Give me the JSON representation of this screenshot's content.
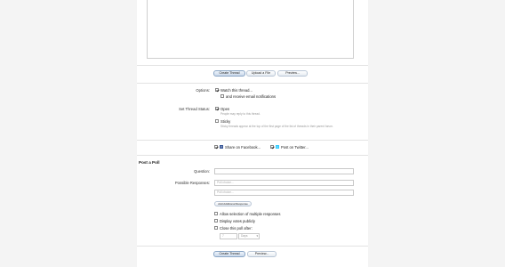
{
  "toolbar": {
    "create_thread_label": "Create Thread",
    "upload_file_label": "Upload a File",
    "preview_label": "Preview..."
  },
  "options": {
    "label": "Options:",
    "watch_thread_label": "Watch this thread...",
    "watch_thread_checked": true,
    "email_notify_label": "and receive email notifications",
    "email_notify_checked": false
  },
  "thread_status": {
    "label": "Set Thread Status:",
    "open_label": "Open",
    "open_checked": true,
    "open_hint": "People may reply to this thread.",
    "sticky_label": "Sticky",
    "sticky_checked": false,
    "sticky_hint": "Sticky threads appear at the top of the first page of the list of threads in their parent forum."
  },
  "share": {
    "facebook_checked": true,
    "facebook_label": "Share on Facebook...",
    "twitter_checked": true,
    "twitter_label": "Post on Twitter..."
  },
  "poll": {
    "title": "Post a Poll",
    "question_label": "Question:",
    "question_value": "",
    "responses_label": "Possible Responses:",
    "responses": [
      {
        "placeholder": "Poll choice..."
      },
      {
        "placeholder": "Poll choice..."
      }
    ],
    "add_response_label": "Add Additional Response",
    "multiple_label": "Allow selection of multiple responses",
    "multiple_checked": false,
    "public_label": "Display votes publicly",
    "public_checked": false,
    "close_label": "Close this poll after:",
    "close_checked": false,
    "close_value": "7",
    "close_unit": "Days"
  },
  "footer": {
    "create_thread_label": "Create Thread",
    "preview_label": "Preview..."
  },
  "colors": {
    "page_bg": "#f4f4f4",
    "content_bg": "#ffffff",
    "button_border": "#b9c6d6",
    "facebook": "#3b5998",
    "twitter": "#33ccff"
  }
}
